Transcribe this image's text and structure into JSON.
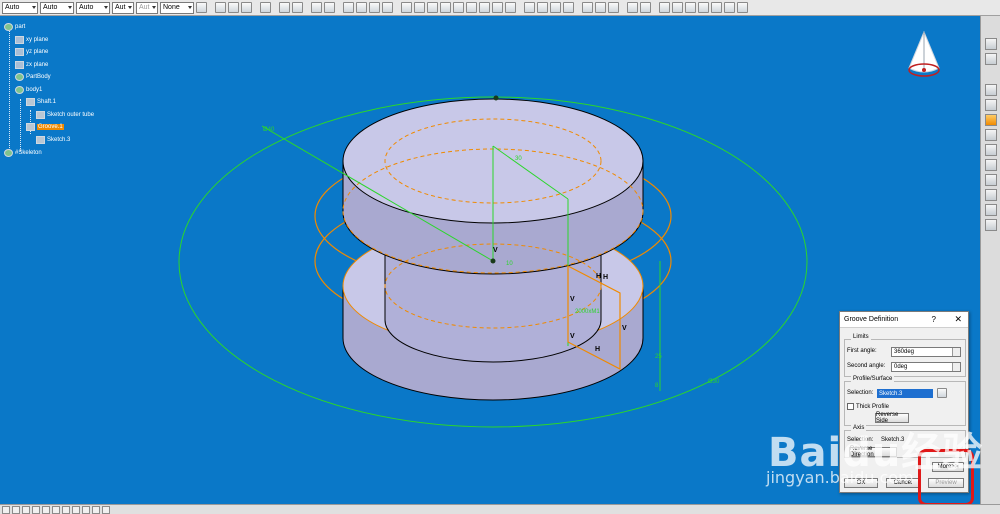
{
  "toolbar": {
    "combos": [
      "Auto",
      "Auto",
      "Auto",
      "Aut",
      "Aut",
      "None"
    ]
  },
  "tree": {
    "items": [
      {
        "label": "part",
        "icon": "gear-icon"
      },
      {
        "label": "xy plane",
        "icon": "plane-icon"
      },
      {
        "label": "yz plane",
        "icon": "plane-icon"
      },
      {
        "label": "zx plane",
        "icon": "plane-icon"
      },
      {
        "label": "PartBody",
        "icon": "gear-icon"
      },
      {
        "label": "body1",
        "icon": "gear-icon"
      },
      {
        "label": "Shaft.1",
        "icon": "shaft-icon"
      },
      {
        "label": "Sketch outer tube",
        "icon": "sketch-icon"
      },
      {
        "label": "Groove.1",
        "icon": "groove-icon",
        "selected": true
      },
      {
        "label": "Sketch.3",
        "icon": "sketch-icon"
      },
      {
        "label": "#Skeleton",
        "icon": "gear-icon"
      }
    ]
  },
  "viewport": {
    "dims": [
      "30",
      "10",
      "25",
      "8",
      "Ø40",
      "Ø30"
    ],
    "constraint_marks": [
      "V",
      "V",
      "H",
      "H",
      "V",
      "V",
      "H"
    ],
    "axis_label": "2000xM1"
  },
  "dialog": {
    "title": "Groove Definition",
    "help": "?",
    "close": "✕",
    "limits_label": "Limits",
    "first_angle_label": "First angle:",
    "first_angle_value": "360deg",
    "second_angle_label": "Second angle:",
    "second_angle_value": "0deg",
    "profile_label": "Profile/Surface",
    "selection_label": "Selection:",
    "selection_value": "Sketch.3",
    "thick_profile_label": "Thick Profile",
    "reverse_side_label": "Reverse Side",
    "axis_label": "Axis",
    "axis_selection_label": "Selection:",
    "axis_selection_value": "Sketch.3",
    "reverse_direction_label": "Reverse Direction",
    "more_button": "More>>",
    "ok_button": "OK",
    "cancel_button": "Cancel",
    "preview_button": "Preview"
  },
  "watermark": {
    "brand": "Baidu经验",
    "site": "jingyan.baidu.com"
  },
  "colors": {
    "background": "#0a78c8",
    "solid_face": "#c8c8e8",
    "sketch_orange": "#f08a00",
    "green_lines": "#2bd62b",
    "highlight_red": "#e01818"
  }
}
